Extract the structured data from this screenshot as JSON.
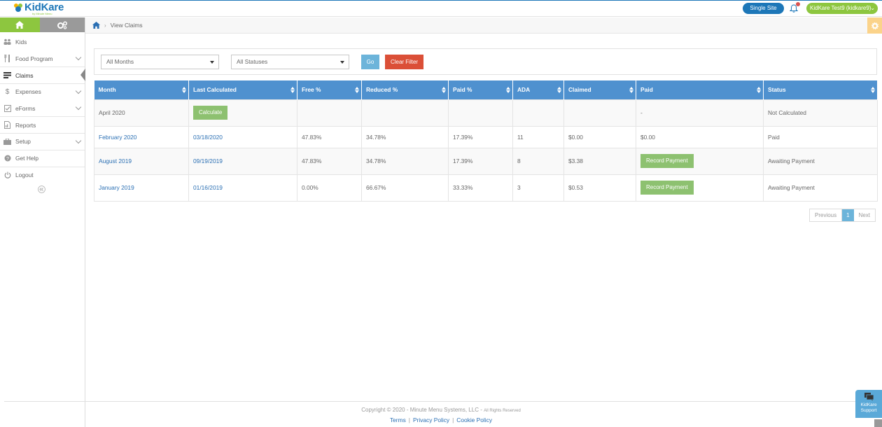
{
  "header": {
    "logo_text": "KidKare",
    "logo_sub": "by Minute Menu",
    "single_site_label": "Single Site",
    "user_label": "KidKare Test9 (kidkare9)",
    "colors": {
      "brand_blue": "#1d77b8",
      "brand_green": "#8dc63f"
    }
  },
  "sidebar": {
    "items": [
      {
        "label": "Kids",
        "icon": "kids-icon",
        "has_chevron": false
      },
      {
        "label": "Food Program",
        "icon": "utensils-icon",
        "has_chevron": true
      },
      {
        "label": "Claims",
        "icon": "claims-icon",
        "has_chevron": false,
        "active": true
      },
      {
        "label": "Expenses",
        "icon": "dollar-icon",
        "has_chevron": true
      },
      {
        "label": "eForms",
        "icon": "checkbox-icon",
        "has_chevron": true
      },
      {
        "label": "Reports",
        "icon": "report-icon",
        "has_chevron": false
      },
      {
        "label": "Setup",
        "icon": "briefcase-icon",
        "has_chevron": true
      },
      {
        "label": "Get Help",
        "icon": "help-icon",
        "has_chevron": false
      },
      {
        "label": "Logout",
        "icon": "power-icon",
        "has_chevron": false
      }
    ]
  },
  "breadcrumb": {
    "current": "View Claims"
  },
  "filters": {
    "month_select": "All Months",
    "status_select": "All Statuses",
    "go_label": "Go",
    "clear_label": "Clear Filter"
  },
  "table": {
    "columns": [
      "Month",
      "Last Calculated",
      "Free %",
      "Reduced %",
      "Paid %",
      "ADA",
      "Claimed",
      "Paid",
      "Status"
    ],
    "rows": [
      {
        "month": "April 2020",
        "last_calculated": "Calculate",
        "free": "",
        "reduced": "",
        "paid_pct": "",
        "ada": "",
        "claimed": "",
        "paid": "-",
        "status": "Not Calculated"
      },
      {
        "month": "February 2020",
        "last_calculated": "03/18/2020",
        "free": "47.83%",
        "reduced": "34.78%",
        "paid_pct": "17.39%",
        "ada": "11",
        "claimed": "$0.00",
        "paid": "$0.00",
        "status": "Paid"
      },
      {
        "month": "August 2019",
        "last_calculated": "09/19/2019",
        "free": "47.83%",
        "reduced": "34.78%",
        "paid_pct": "17.39%",
        "ada": "8",
        "claimed": "$3.38",
        "paid": "Record Payment",
        "status": "Awaiting Payment"
      },
      {
        "month": "January 2019",
        "last_calculated": "01/16/2019",
        "free": "0.00%",
        "reduced": "66.67%",
        "paid_pct": "33.33%",
        "ada": "3",
        "claimed": "$0.53",
        "paid": "Record Payment",
        "status": "Awaiting Payment"
      }
    ]
  },
  "pagination": {
    "previous": "Previous",
    "current": "1",
    "next": "Next"
  },
  "footer": {
    "copyright": "Copyright © 2020 - Minute Menu Systems, LLC -",
    "rights": "All Rights Reserved",
    "links": [
      "Terms",
      "Privacy Policy",
      "Cookie Policy"
    ],
    "support_label_1": "KidKare",
    "support_label_2": "Support"
  }
}
